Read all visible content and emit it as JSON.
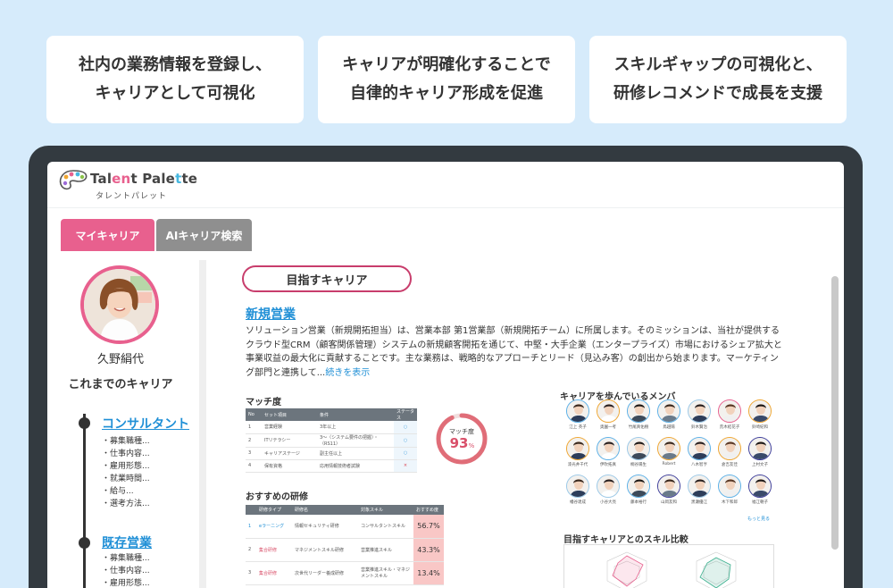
{
  "features": [
    {
      "line1": "社内の業務情報を登録し、",
      "line2": "キャリアとして可視化"
    },
    {
      "line1": "キャリアが明確化することで",
      "line2": "自律的キャリア形成を促進"
    },
    {
      "line1": "スキルギャップの可視化と、",
      "line2": "研修レコメンドで成長を支援"
    }
  ],
  "app": {
    "logo_pre": "Tal",
    "logo_mid": "en",
    "logo_post": "t Pale",
    "logo_mid2": "t",
    "logo_end": "te",
    "logo_sub": "タレントパレット"
  },
  "tabs": {
    "active": "マイキャリア",
    "inactive": "AIキャリア検索"
  },
  "profile": {
    "name": "久野絹代",
    "career_heading": "これまでのキャリア"
  },
  "timeline": [
    {
      "title": "コンサルタント",
      "items": [
        "・募集職種...",
        "・仕事内容...",
        "・雇用形態...",
        "・就業時間...",
        "・給与...",
        "・選考方法..."
      ]
    },
    {
      "title": "既存営業",
      "items": [
        "・募集職種...",
        "・仕事内容...",
        "・雇用形態..."
      ]
    }
  ],
  "goal": {
    "pill": "目指すキャリア",
    "job_title": "新規営業",
    "description": "ソリューション営業（新規開拓担当）は、営業本部 第1営業部（新規開拓チーム）に所属します。そのミッションは、当社が提供するクラウド型CRM（顧客関係管理）システムの新規顧客開拓を通じて、中堅・大手企業（エンタープライズ）市場におけるシェア拡大と事業収益の最大化に貢献することです。主な業務は、戦略的なアプローチとリード（見込み客）の創出から始まります。マーケティング部門と連携して...",
    "read_more": "続きを表示"
  },
  "match": {
    "title": "マッチ度",
    "headers": [
      "No",
      "セット項目",
      "条件",
      "ステータス"
    ],
    "rows": [
      {
        "no": "1",
        "item": "営業経験",
        "cond": "3年以上",
        "status": "○"
      },
      {
        "no": "2",
        "item": "ITリテラシー",
        "cond": "3〜（システム要件の把握）・（RS11）",
        "status": "○"
      },
      {
        "no": "3",
        "item": "キャリアステージ",
        "cond": "副主任以上",
        "status": "○"
      },
      {
        "no": "4",
        "item": "保有資格",
        "cond": "応用情報技術者試験",
        "status": "×"
      }
    ],
    "gauge_label": "マッチ度",
    "gauge_value": "93",
    "gauge_unit": "%",
    "gauge_fraction": 0.93
  },
  "recommend": {
    "title": "おすすめの研修",
    "headers": [
      "",
      "研修タイプ",
      "研修名",
      "対象スキル",
      "おすすめ度"
    ],
    "rows": [
      {
        "no": "1",
        "type": "eラーニング",
        "name": "情報セキュリティ研修",
        "skill": "コンサルタントスキル",
        "pct": "56.7%"
      },
      {
        "no": "2",
        "type": "集合研修",
        "name": "マネジメントスキル研修",
        "skill": "営業推進スキル",
        "pct": "43.3%"
      },
      {
        "no": "3",
        "type": "集合研修",
        "name": "次世代リーダー養成研修",
        "skill": "営業推進スキル・マネジメントスキル",
        "pct": "13.4%"
      }
    ]
  },
  "members": {
    "title": "キャリアを歩んでいるメンバ",
    "list": [
      {
        "name": "江上 英子"
      },
      {
        "name": "奥園一考"
      },
      {
        "name": "竹尾真佑樹"
      },
      {
        "name": "鳥越陽"
      },
      {
        "name": "鈴木賢治"
      },
      {
        "name": "荒木結花子"
      },
      {
        "name": "鈴崎紀和"
      },
      {
        "name": "漆光井千代"
      },
      {
        "name": "伊吹拓真"
      },
      {
        "name": "桐谷陽生"
      },
      {
        "name": "Robert"
      },
      {
        "name": "八木智亨"
      },
      {
        "name": "倉吉友佳"
      },
      {
        "name": "上村文子"
      },
      {
        "name": "幡谷達成"
      },
      {
        "name": "小谷大亮"
      },
      {
        "name": "藤本裕行"
      },
      {
        "name": "山岡友和"
      },
      {
        "name": "黒瀬優江"
      },
      {
        "name": "木下和郎"
      },
      {
        "name": "福江朝子"
      }
    ],
    "more": "もっと見る"
  },
  "skill": {
    "title": "目指すキャリアとのスキル比較"
  }
}
